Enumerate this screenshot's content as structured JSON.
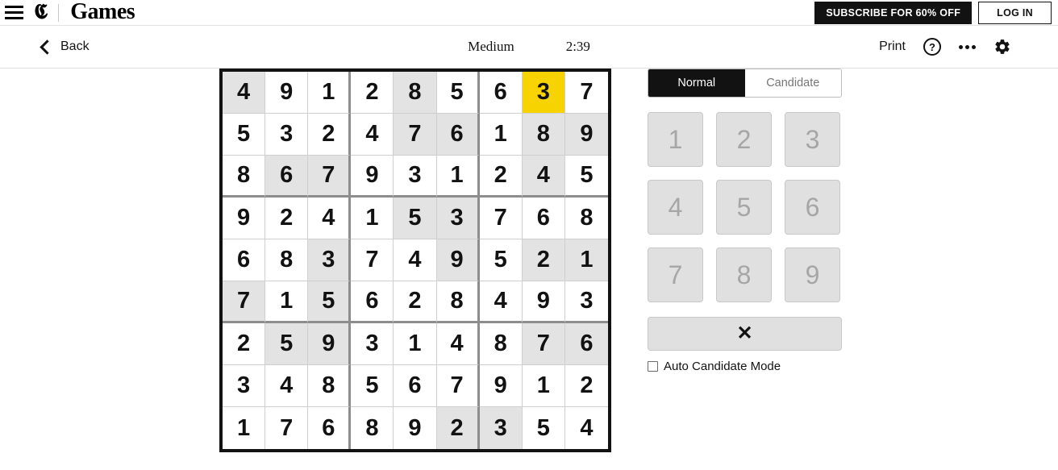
{
  "topbar": {
    "menu_icon": "hamburger-icon",
    "logo_mark": "𝕮",
    "logo_word": "Games",
    "subscribe_label": "SUBSCRIBE FOR 60% OFF",
    "login_label": "LOG IN"
  },
  "game_header": {
    "back_label": "Back",
    "difficulty": "Medium",
    "timer": "2:39",
    "print_label": "Print",
    "help_glyph": "?",
    "more_icon": "more-options-icon",
    "settings_icon": "gear-icon"
  },
  "board": {
    "selected_cell": {
      "row": 1,
      "col": 8,
      "value": "3"
    },
    "rows": [
      {
        "values": [
          "4",
          "9",
          "1",
          "2",
          "8",
          "5",
          "6",
          "3",
          "7"
        ],
        "shaded": [
          1,
          0,
          0,
          0,
          1,
          0,
          0,
          0,
          0
        ],
        "selected": [
          0,
          0,
          0,
          0,
          0,
          0,
          0,
          1,
          0
        ]
      },
      {
        "values": [
          "5",
          "3",
          "2",
          "4",
          "7",
          "6",
          "1",
          "8",
          "9"
        ],
        "shaded": [
          0,
          0,
          0,
          0,
          1,
          1,
          0,
          1,
          1
        ],
        "selected": [
          0,
          0,
          0,
          0,
          0,
          0,
          0,
          0,
          0
        ]
      },
      {
        "values": [
          "8",
          "6",
          "7",
          "9",
          "3",
          "1",
          "2",
          "4",
          "5"
        ],
        "shaded": [
          0,
          1,
          1,
          0,
          0,
          0,
          0,
          1,
          0
        ],
        "selected": [
          0,
          0,
          0,
          0,
          0,
          0,
          0,
          0,
          0
        ]
      },
      {
        "values": [
          "9",
          "2",
          "4",
          "1",
          "5",
          "3",
          "7",
          "6",
          "8"
        ],
        "shaded": [
          0,
          0,
          0,
          0,
          1,
          1,
          0,
          0,
          0
        ],
        "selected": [
          0,
          0,
          0,
          0,
          0,
          0,
          0,
          0,
          0
        ]
      },
      {
        "values": [
          "6",
          "8",
          "3",
          "7",
          "4",
          "9",
          "5",
          "2",
          "1"
        ],
        "shaded": [
          0,
          0,
          1,
          0,
          0,
          1,
          0,
          1,
          1
        ],
        "selected": [
          0,
          0,
          0,
          0,
          0,
          0,
          0,
          0,
          0
        ]
      },
      {
        "values": [
          "7",
          "1",
          "5",
          "6",
          "2",
          "8",
          "4",
          "9",
          "3"
        ],
        "shaded": [
          1,
          0,
          1,
          0,
          0,
          0,
          0,
          0,
          0
        ],
        "selected": [
          0,
          0,
          0,
          0,
          0,
          0,
          0,
          0,
          0
        ]
      },
      {
        "values": [
          "2",
          "5",
          "9",
          "3",
          "1",
          "4",
          "8",
          "7",
          "6"
        ],
        "shaded": [
          0,
          1,
          1,
          0,
          0,
          0,
          0,
          1,
          1
        ],
        "selected": [
          0,
          0,
          0,
          0,
          0,
          0,
          0,
          0,
          0
        ]
      },
      {
        "values": [
          "3",
          "4",
          "8",
          "5",
          "6",
          "7",
          "9",
          "1",
          "2"
        ],
        "shaded": [
          0,
          0,
          0,
          0,
          0,
          0,
          0,
          0,
          0
        ],
        "selected": [
          0,
          0,
          0,
          0,
          0,
          0,
          0,
          0,
          0
        ]
      },
      {
        "values": [
          "1",
          "7",
          "6",
          "8",
          "9",
          "2",
          "3",
          "5",
          "4"
        ],
        "shaded": [
          0,
          0,
          0,
          0,
          0,
          1,
          1,
          0,
          0
        ],
        "selected": [
          0,
          0,
          0,
          0,
          0,
          0,
          0,
          0,
          0
        ]
      }
    ]
  },
  "panel": {
    "mode_normal": "Normal",
    "mode_candidate": "Candidate",
    "active_mode": "Normal",
    "numbers": [
      "1",
      "2",
      "3",
      "4",
      "5",
      "6",
      "7",
      "8",
      "9"
    ],
    "erase_glyph": "✕",
    "auto_candidate_label": "Auto Candidate Mode",
    "auto_candidate_checked": false
  },
  "colors": {
    "selected_cell": "#f7d302",
    "shaded_cell": "#e3e3e3",
    "accent_dark": "#121212",
    "numpad_bg": "#e0e0e0",
    "numpad_text": "#a6a6a6"
  }
}
